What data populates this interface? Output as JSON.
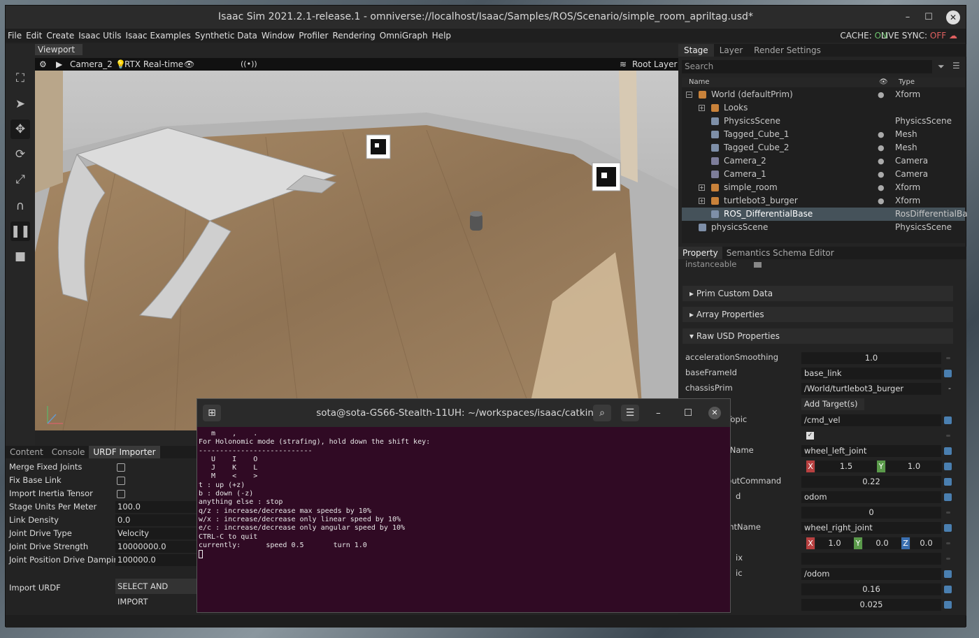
{
  "window": {
    "title": "Isaac Sim 2021.2.1-release.1 - omniverse://localhost/Isaac/Samples/ROS/Scenario/simple_room_apriltag.usd*"
  },
  "menu": [
    "File",
    "Edit",
    "Create",
    "Isaac Utils",
    "Isaac Examples",
    "Synthetic Data",
    "Window",
    "Profiler",
    "Rendering",
    "OmniGraph",
    "Help"
  ],
  "status": {
    "cache_label": "CACHE:",
    "cache_value": "ON",
    "sync_label": "LIVE SYNC:",
    "sync_value": "OFF"
  },
  "viewport": {
    "tab": "Viewport",
    "camera": "Camera_2",
    "render_mode": "RTX Real-time",
    "layer": "Root Layer",
    "stream_icon": "((•))"
  },
  "bottom_tabs": [
    "Content",
    "Console",
    "URDF Importer"
  ],
  "urdf": {
    "merge_fixed_joints": "Merge Fixed Joints",
    "fix_base_link": "Fix Base Link",
    "import_inertia": "Import Inertia Tensor",
    "stage_units_label": "Stage Units Per Meter",
    "stage_units_value": "100.0",
    "link_density_label": "Link Density",
    "link_density_value": "0.0",
    "joint_drive_type_label": "Joint Drive Type",
    "joint_drive_type_value": "Velocity",
    "joint_drive_strength_label": "Joint Drive Strength",
    "joint_drive_strength_value": "10000000.0",
    "joint_pos_damping_label": "Joint Position Drive Damping",
    "joint_pos_damping_value": "100000.0",
    "import_label": "Import URDF",
    "import_button": "SELECT AND IMPORT"
  },
  "stage": {
    "tabs": [
      "Stage",
      "Layer",
      "Render Settings"
    ],
    "search_placeholder": "Search",
    "col_name": "Name",
    "col_type": "Type",
    "rows": [
      {
        "name": "World (defaultPrim)",
        "type": "Xform"
      },
      {
        "name": "Looks",
        "type": ""
      },
      {
        "name": "PhysicsScene",
        "type": "PhysicsScene"
      },
      {
        "name": "Tagged_Cube_1",
        "type": "Mesh"
      },
      {
        "name": "Tagged_Cube_2",
        "type": "Mesh"
      },
      {
        "name": "Camera_2",
        "type": "Camera"
      },
      {
        "name": "Camera_1",
        "type": "Camera"
      },
      {
        "name": "simple_room",
        "type": "Xform"
      },
      {
        "name": "turtlebot3_burger",
        "type": "Xform"
      },
      {
        "name": "ROS_DifferentialBase",
        "type": "RosDifferentialBa"
      },
      {
        "name": "physicsScene",
        "type": "PhysicsScene"
      }
    ]
  },
  "property": {
    "tabs": [
      "Property",
      "Semantics Schema Editor"
    ],
    "instanceable": "instanceable",
    "sections": [
      "Prim Custom Data",
      "Array Properties",
      "Raw USD Properties"
    ],
    "fields": {
      "accelerationSmoothing": {
        "label": "accelerationSmoothing",
        "value": "1.0"
      },
      "baseFrameId": {
        "label": "baseFrameId",
        "value": "base_link"
      },
      "chassisPrim": {
        "label": "chassisPrim",
        "value": "/World/turtlebot3_burger"
      },
      "add_targets": "Add Target(s)",
      "cmdvel": {
        "label": "bTopic",
        "value": "/cmd_vel"
      },
      "leftJoint": {
        "label": "ntName",
        "value": "wheel_left_joint"
      },
      "vec1": {
        "x": "1.5",
        "y": "1.0"
      },
      "timeout": {
        "label": "houtCommand",
        "value": "0.22"
      },
      "odomFrame": {
        "label": "d",
        "value": "odom"
      },
      "zero": {
        "value": "0"
      },
      "rightJoint": {
        "label": "ointName",
        "value": "wheel_right_joint"
      },
      "vec2": {
        "x": "1.0",
        "y": "0.0",
        "z": "0.0"
      },
      "prefix": {
        "label": "ix",
        "value": ""
      },
      "odomTopic": {
        "label": "ic",
        "value": "/odom"
      },
      "wheelBase": {
        "value": "0.16"
      },
      "wheelRadius": {
        "value": "0.025"
      }
    }
  },
  "terminal": {
    "title": "sota@sota-GS66-Stealth-11UH: ~/workspaces/isaac/catkin_ws",
    "lines": [
      "   m    ,    .",
      "",
      "For Holonomic mode (strafing), hold down the shift key:",
      "---------------------------",
      "   U    I    O",
      "   J    K    L",
      "   M    <    >",
      "",
      "t : up (+z)",
      "b : down (-z)",
      "",
      "anything else : stop",
      "",
      "q/z : increase/decrease max speeds by 10%",
      "w/x : increase/decrease only linear speed by 10%",
      "e/c : increase/decrease only angular speed by 10%",
      "",
      "CTRL-C to quit",
      "",
      "currently:      speed 0.5       turn 1.0"
    ]
  },
  "colors": {
    "accent": "#4a7fb0",
    "terminal_bg": "#300a24",
    "selected_row": "#45525a"
  }
}
